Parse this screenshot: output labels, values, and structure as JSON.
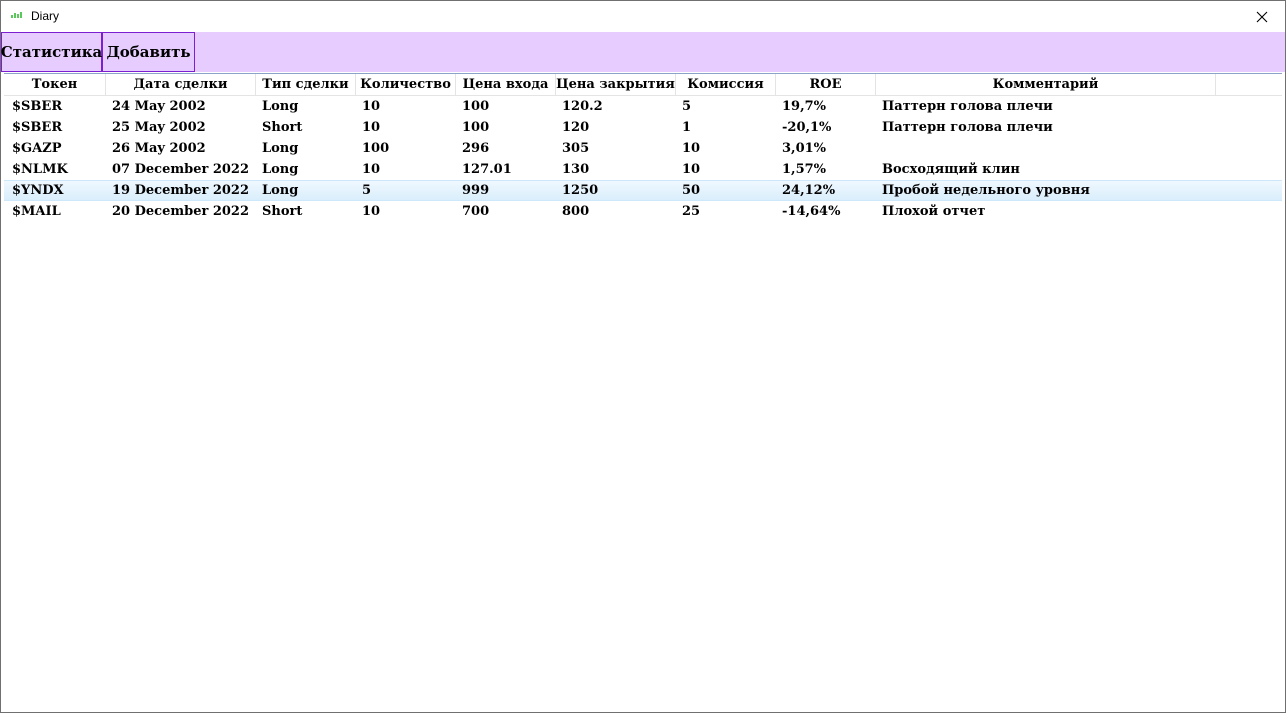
{
  "window": {
    "title": "Diary",
    "icon": "app-chart-icon",
    "close_icon": "close-icon"
  },
  "toolbar": {
    "stats_label": "Статистика",
    "add_label": "Добавить"
  },
  "colors": {
    "toolbar_bg": "#e6ccff",
    "button_border": "#7b1fd0",
    "selection": "#d9eefc"
  },
  "table": {
    "columns": [
      "Токен",
      "Дата сделки",
      "Тип сделки",
      "Количество",
      "Цена входа",
      "Цена закрытия",
      "Комиссия",
      "ROE",
      "Комментарий"
    ],
    "rows": [
      [
        "$SBER",
        "24 May 2002",
        "Long",
        "10",
        "100",
        "120.2",
        "5",
        "19,7%",
        "Паттерн голова плечи"
      ],
      [
        "$SBER",
        "25 May 2002",
        "Short",
        "10",
        "100",
        "120",
        "1",
        "-20,1%",
        "Паттерн голова плечи"
      ],
      [
        "$GAZP",
        "26 May 2002",
        "Long",
        "100",
        "296",
        "305",
        "10",
        "3,01%",
        ""
      ],
      [
        "$NLMK",
        "07 December 2022",
        "Long",
        "10",
        "127.01",
        "130",
        "10",
        "1,57%",
        "Восходящий клин"
      ],
      [
        "$YNDX",
        "19 December 2022",
        "Long",
        "5",
        "999",
        "1250",
        "50",
        "24,12%",
        "Пробой недельного уровня"
      ],
      [
        "$MAIL",
        "20 December 2022",
        "Short",
        "10",
        "700",
        "800",
        "25",
        "-14,64%",
        "Плохой отчет"
      ]
    ],
    "selected_row": 4
  }
}
